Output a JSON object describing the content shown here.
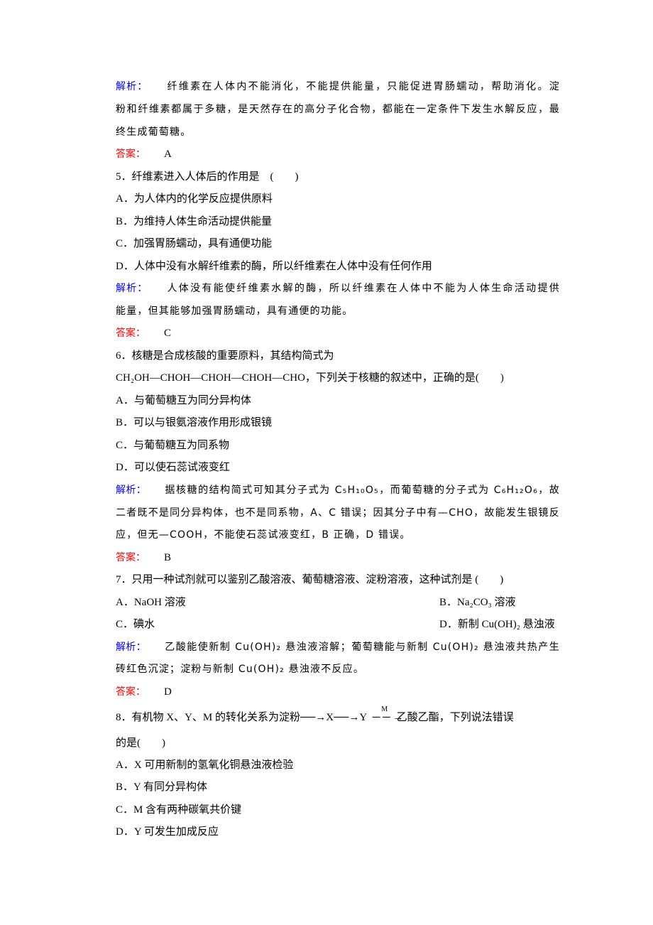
{
  "labels": {
    "analysis": "解析：",
    "answer": "答案："
  },
  "block4": {
    "analysis_lines": [
      "纤维素在人体内不能消化，不能提供能量，只能促进胃肠蠕动，帮助消化。淀",
      "粉和纤维素都属于多糖，是天然存在的高分子化合物，都能在一定条件下发生水解反应，最",
      "终生成葡萄糖。"
    ],
    "answer": "A"
  },
  "q5": {
    "stem": "5．纤维素进入人体后的作用是　(　　)",
    "options": [
      "A．为人体内的化学反应提供原料",
      "B．为维持人体生命活动提供能量",
      "C．加强胃肠蠕动，具有通便功能",
      "D．人体中没有水解纤维素的酶，所以纤维素在人体中没有任何作用"
    ],
    "analysis_lines": [
      "人体没有能使纤维素水解的酶，所以纤维素在人体中不能为人体生命活动提供",
      "能量，但其能够加强胃肠蠕动，具有通便的功能。"
    ],
    "answer": "C"
  },
  "q6": {
    "stem_line1": "6．核糖是合成核酸的重要原料，其结构简式为",
    "stem_line2": "CH₂OH—CHOH—CHOH—CHOH—CHO，下列关于核糖的叙述中，正确的是(　　)",
    "options": [
      "A．与葡萄糖互为同分异构体",
      "B．可以与银氨溶液作用形成银镜",
      "C．与葡萄糖互为同系物",
      "D．可以使石蕊试液变红"
    ],
    "analysis_line1_a": "据核糖的结构简式可知其分子式为 C₅H₁₀O₅，而葡萄糖的分子式为 C₆H₁₂O₆，故",
    "analysis_line2": "二者既不是同分异构体，也不是同系物，A、C 错误；因其分子中有—CHO，故能发生银镜反",
    "analysis_line3": "应，但无—COOH，不能使石蕊试液变红，B 正确，D 错误。",
    "answer": "B"
  },
  "q7": {
    "stem": "7．只用一种试剂就可以鉴别乙酸溶液、葡萄糖溶液、淀粉溶液，这种试剂是 (　　)",
    "options": [
      "A．NaOH 溶液",
      "B．Na₂CO₃ 溶液",
      "C．碘水",
      "D．新制 Cu(OH)₂ 悬浊液"
    ],
    "analysis_line1": "乙酸能使新制 Cu(OH)₂ 悬浊液溶解；葡萄糖能与新制 Cu(OH)₂ 悬浊液共热产生",
    "analysis_line2": "砖红色沉淀；淀粉与新制 Cu(OH)₂ 悬浊液不反应。",
    "answer": "D"
  },
  "q8": {
    "stem_prefix": "8．有机物 X、Y、M 的转化关系为淀粉",
    "arrow1": "──→",
    "node_x": "X",
    "arrow2": "──→",
    "node_y": "Y",
    "arrow_label": "M",
    "arrow3": "─ ─ →",
    "stem_suffix": "乙酸乙酯，下列说法错误",
    "stem_line2": "的是(　　)",
    "options": [
      "A．X 可用新制的氢氧化铜悬浊液检验",
      "B．Y 有同分异构体",
      "C．M 含有两种碳氧共价键",
      "D．Y 可发生加成反应"
    ]
  }
}
